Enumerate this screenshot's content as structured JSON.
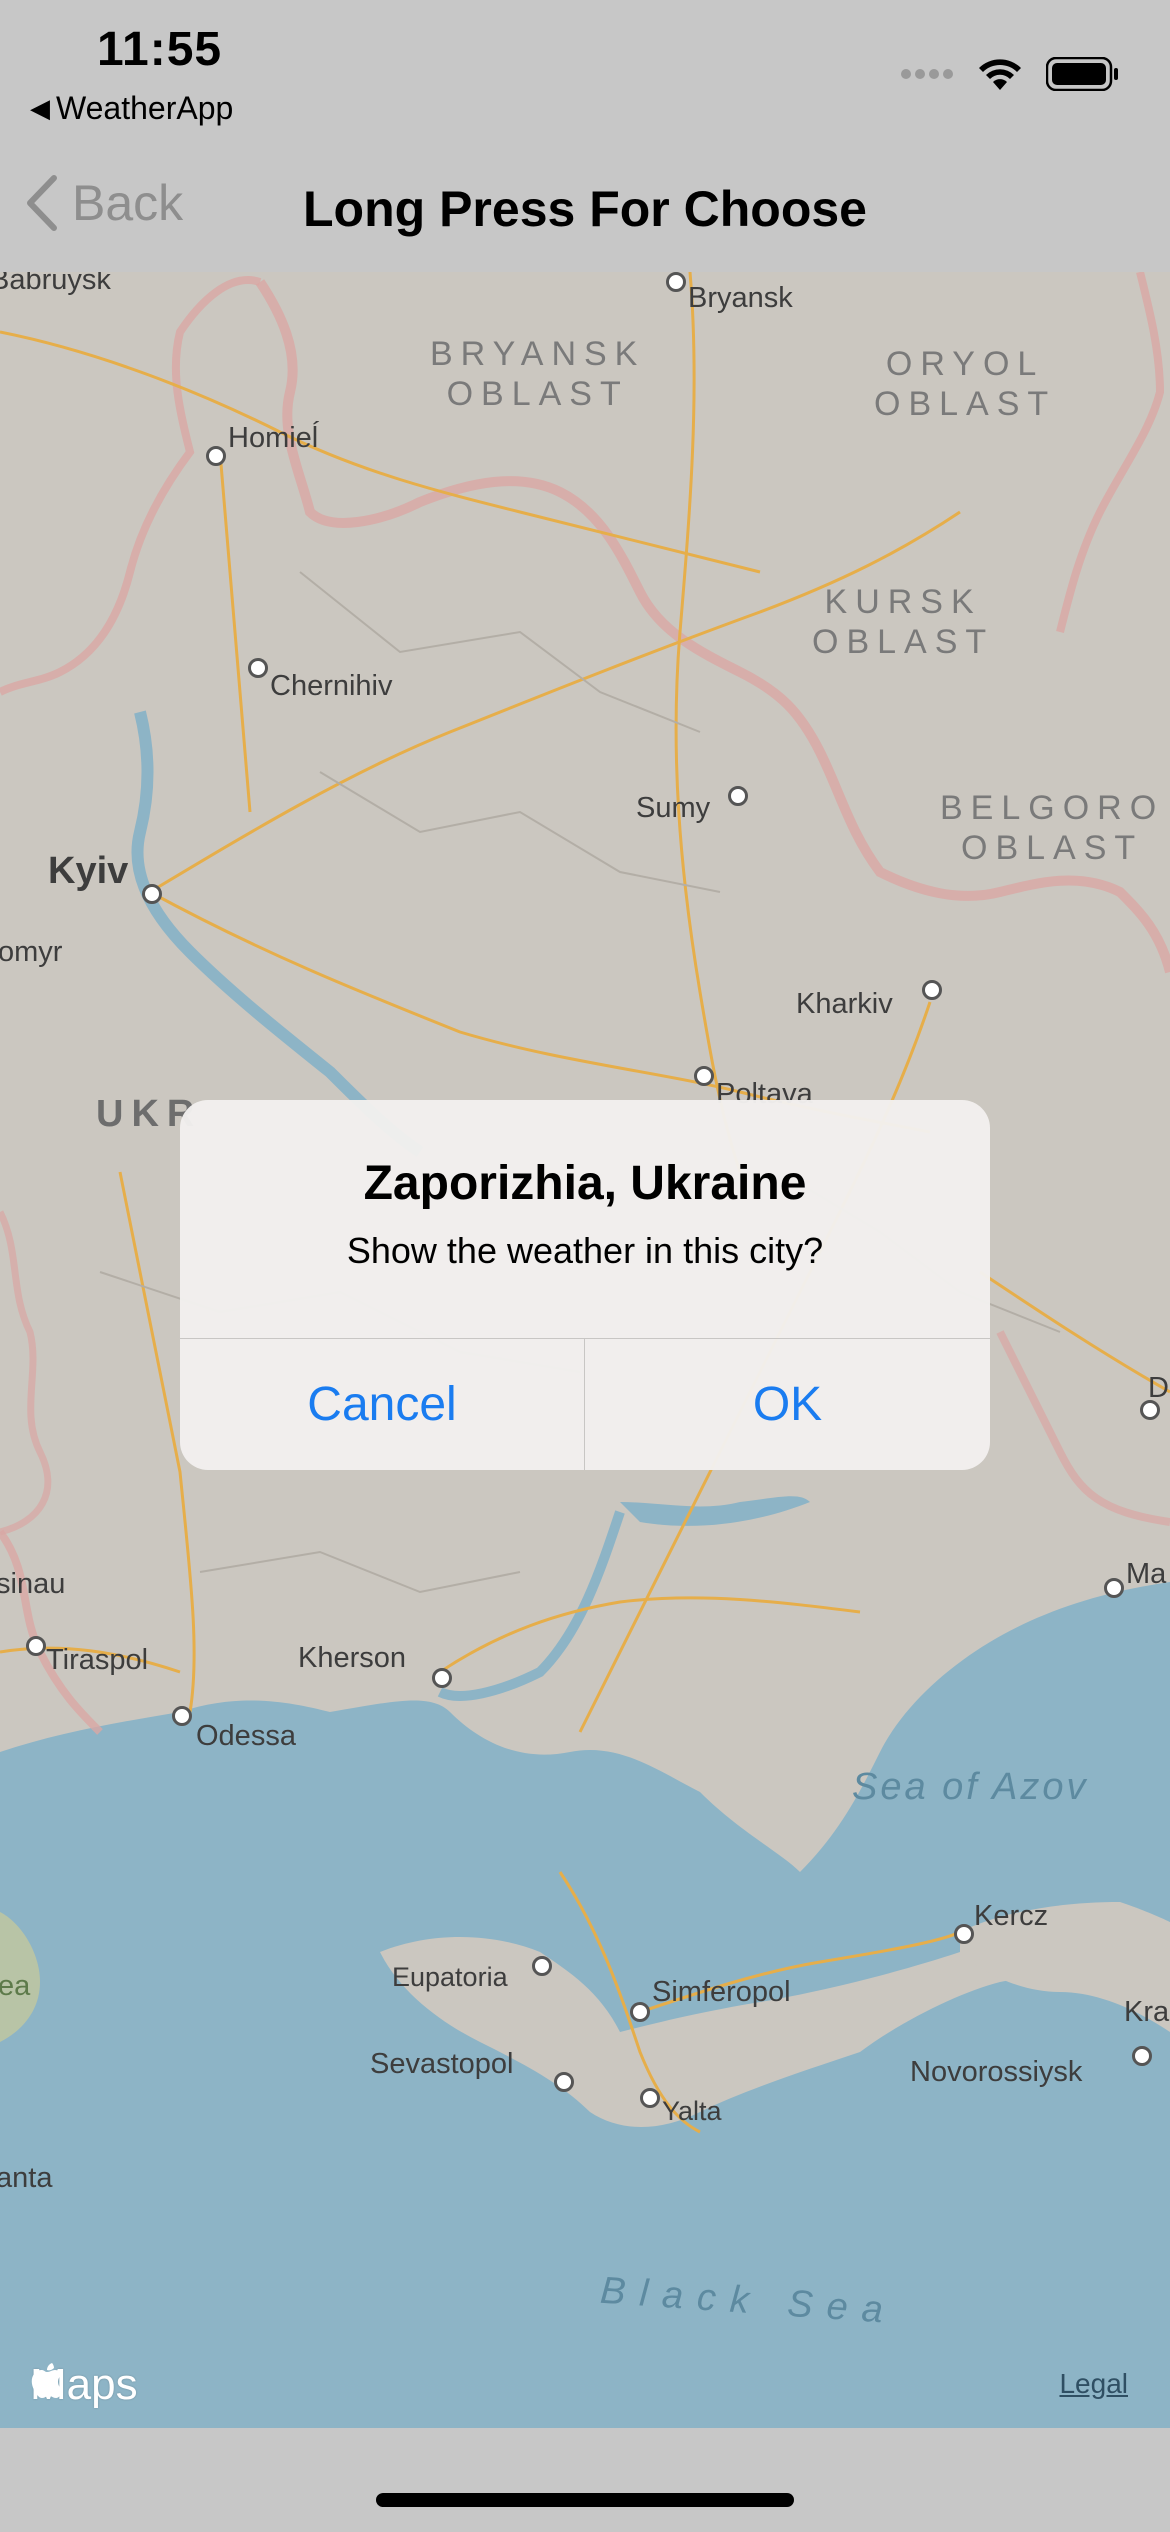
{
  "status_bar": {
    "time": "11:55",
    "back_app_label": "WeatherApp",
    "icons": [
      "cellular-dots-icon",
      "wifi-icon",
      "battery-icon"
    ]
  },
  "nav": {
    "back_label": "Back",
    "title": "Long Press For Choose"
  },
  "map": {
    "cities": [
      "Babruysk",
      "Bryansk",
      "Homieĺ",
      "Chernihiv",
      "Sumy",
      "Kyiv",
      "omyr",
      "Kharkiv",
      "Poltava",
      "sinau",
      "Tiraspol",
      "Kherson",
      "Odessa",
      "Eupatoria",
      "Simferopol",
      "Sevastopol",
      "Yalta",
      "Kercz",
      "Novorossiysk",
      "anta",
      "Kra",
      "Ma",
      "D"
    ],
    "regions": {
      "bryansk": "BRYANSK\nOBLAST",
      "oryol": "ORYOL\nOBLAST",
      "kursk": "KURSK\nOBLAST",
      "belgorod": "BELGORO\nOBLAST",
      "ukraine": "UKR"
    },
    "seas": {
      "azov": "Sea of Azov",
      "black": "Black Sea",
      "left_edge": "ea"
    },
    "brand": "Maps",
    "legal": "Legal",
    "colors": {
      "land": "#cbc7c0",
      "water": "#8db4c6",
      "border": "#d9a7a4",
      "road": "#e6ae4a"
    }
  },
  "alert": {
    "title": "Zaporizhia, Ukraine",
    "message": "Show the weather in this city?",
    "cancel_label": "Cancel",
    "ok_label": "OK",
    "accent": "#1a7cf0"
  }
}
